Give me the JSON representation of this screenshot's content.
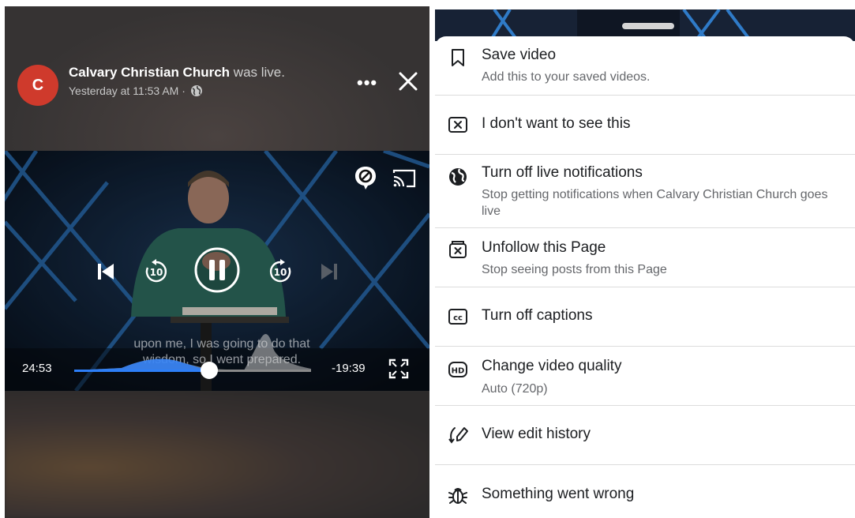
{
  "post": {
    "avatar_letter": "C",
    "page_name": "Calvary Christian Church",
    "title_suffix": "was live.",
    "timestamp": "Yesterday at 11:53 AM ·",
    "more_icon": "more-dots-icon",
    "close_icon": "close-icon"
  },
  "video": {
    "elapsed": "24:53",
    "remaining": "-19:39",
    "caption_line1": "upon me, I was going to do that",
    "caption_line2": "wisdom, so I went prepared.",
    "progress": 0.57,
    "accent_color": "#2d7ff9"
  },
  "menu": {
    "items": [
      {
        "icon": "bookmark-icon",
        "label": "Save video",
        "sub": "Add this to your saved videos."
      },
      {
        "icon": "hide-x-icon",
        "label": "I don't want to see this",
        "sub": ""
      },
      {
        "icon": "globe-icon",
        "label": "Turn off live notifications",
        "sub": "Stop getting notifications when Calvary Christian Church goes live"
      },
      {
        "icon": "unfollow-icon",
        "label": "Unfollow this Page",
        "sub": "Stop seeing posts from this Page"
      },
      {
        "icon": "captions-icon",
        "label": "Turn off captions",
        "sub": ""
      },
      {
        "icon": "hd-icon",
        "label": "Change video quality",
        "sub": "Auto (720p)"
      },
      {
        "icon": "edit-history-icon",
        "label": "View edit history",
        "sub": ""
      },
      {
        "icon": "bug-icon",
        "label": "Something went wrong",
        "sub": ""
      }
    ]
  }
}
